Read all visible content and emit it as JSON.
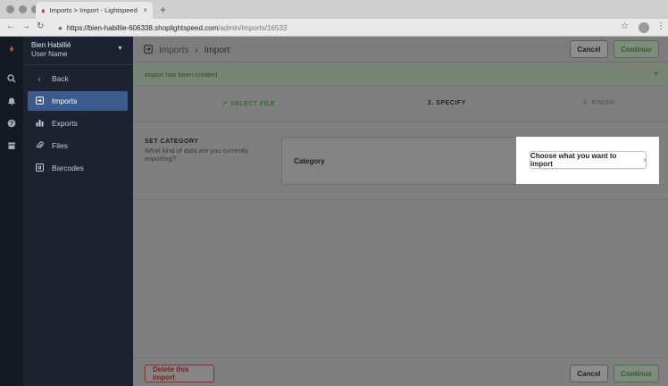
{
  "browser": {
    "tab_title": "Imports > Import - Lightspeed",
    "tab_close": "×",
    "new_tab": "+",
    "url_host": "https://bien-habillie-606338.shoplightspeed.com",
    "url_path": "/admin/imports/16533"
  },
  "account": {
    "name": "Bien Habillié",
    "user": "User Name"
  },
  "sidebar": {
    "items": [
      {
        "label": "Back",
        "icon": "chevron-left-icon"
      },
      {
        "label": "Imports",
        "icon": "import-icon",
        "active": true
      },
      {
        "label": "Exports",
        "icon": "bar-chart-icon"
      },
      {
        "label": "Files",
        "icon": "paperclip-icon"
      },
      {
        "label": "Barcodes",
        "icon": "barcode-icon"
      }
    ]
  },
  "header": {
    "crumb_parent": "Imports",
    "crumb_current": "Import",
    "cancel_label": "Cancel",
    "continue_label": "Continue"
  },
  "alert": {
    "text": "Import has been created",
    "close": "×"
  },
  "steps": [
    {
      "label": "SELECT FILE",
      "state": "done"
    },
    {
      "label": "2. SPECIFY",
      "state": "current"
    },
    {
      "label": "3. FINISH",
      "state": "todo"
    }
  ],
  "category_section": {
    "title": "SET CATEGORY",
    "description": "What kind of data are you currently importing?",
    "field_label": "Category",
    "button_label": "Choose what you want to import"
  },
  "footer": {
    "delete_label": "Delete this import",
    "cancel_label": "Cancel",
    "continue_label": "Continue"
  },
  "colors": {
    "sidebar_bg": "#1c2230",
    "rail_bg": "#131923",
    "active_item": "#3b5b8c",
    "success_green": "#3f7b3f",
    "danger_red": "#8b2d2d"
  }
}
